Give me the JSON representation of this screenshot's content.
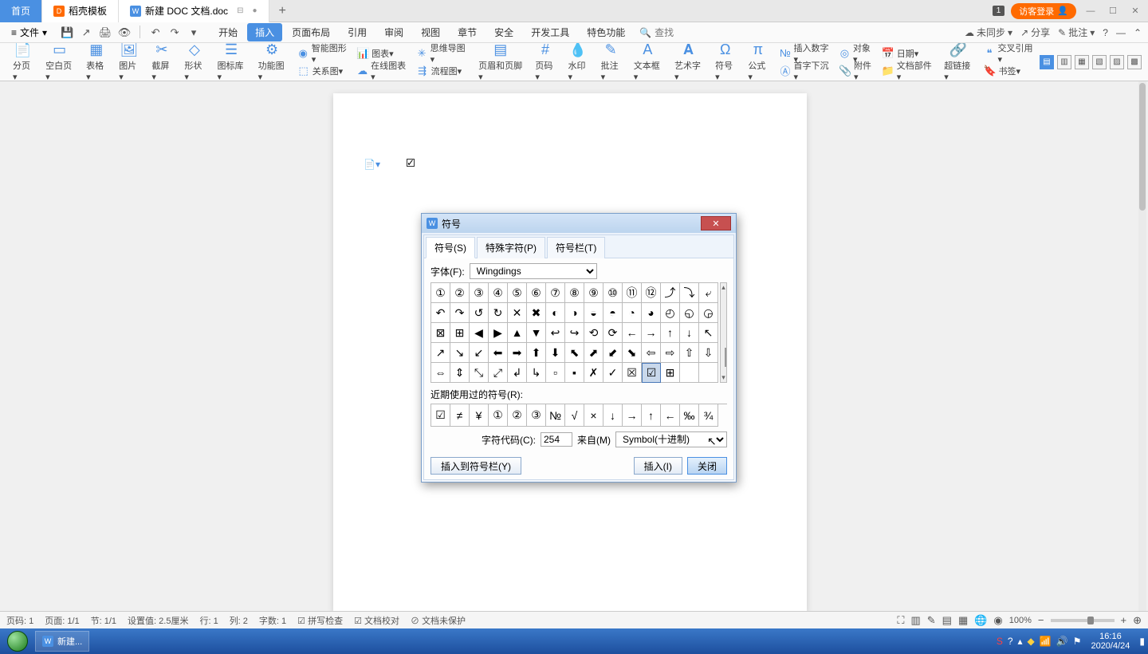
{
  "tabs": {
    "home": "首页",
    "template": "稻壳模板",
    "doc": "新建 DOC 文档.doc"
  },
  "top_right": {
    "badge": "1",
    "login": "访客登录"
  },
  "file_menu": "文件",
  "menu_tabs": [
    "开始",
    "插入",
    "页面布局",
    "引用",
    "审阅",
    "视图",
    "章节",
    "安全",
    "开发工具",
    "特色功能"
  ],
  "search": "查找",
  "menu_right": {
    "sync": "未同步",
    "share": "分享",
    "annotate": "批注"
  },
  "ribbon": {
    "big": [
      {
        "icon": "📄",
        "label": "分页"
      },
      {
        "icon": "▭",
        "label": "空白页"
      },
      {
        "icon": "▦",
        "label": "表格"
      },
      {
        "icon": "🖼",
        "label": "图片"
      },
      {
        "icon": "✂",
        "label": "截屏"
      },
      {
        "icon": "◇",
        "label": "形状"
      },
      {
        "icon": "☰",
        "label": "图标库"
      },
      {
        "icon": "⚙",
        "label": "功能图"
      }
    ],
    "group1": [
      {
        "icon": "◉",
        "label": "智能图形"
      },
      {
        "icon": "⬚",
        "label": "关系图"
      }
    ],
    "group2": [
      {
        "icon": "📊",
        "label": "图表"
      },
      {
        "icon": "☁",
        "label": "在线图表"
      }
    ],
    "group3": [
      {
        "icon": "✳",
        "label": "思维导图"
      },
      {
        "icon": "⇶",
        "label": "流程图"
      }
    ],
    "big2": [
      {
        "icon": "▤",
        "label": "页眉和页脚"
      },
      {
        "icon": "#",
        "label": "页码"
      },
      {
        "icon": "💧",
        "label": "水印"
      },
      {
        "icon": "✎",
        "label": "批注"
      },
      {
        "icon": "A",
        "label": "文本框"
      },
      {
        "icon": "𝐀",
        "label": "艺术字"
      },
      {
        "icon": "Ω",
        "label": "符号"
      },
      {
        "icon": "π",
        "label": "公式"
      }
    ],
    "group4": [
      {
        "icon": "№",
        "label": "插入数字"
      },
      {
        "icon": "Ⓐ",
        "label": "首字下沉"
      }
    ],
    "group5": [
      {
        "icon": "◎",
        "label": "对象"
      },
      {
        "icon": "📎",
        "label": "附件"
      }
    ],
    "group6": [
      {
        "icon": "📅",
        "label": "日期"
      },
      {
        "icon": "📁",
        "label": "文档部件"
      }
    ],
    "big3": [
      {
        "icon": "🔗",
        "label": "超链接"
      }
    ],
    "group7": [
      {
        "icon": "❝",
        "label": "交叉引用"
      },
      {
        "icon": "🔖",
        "label": "书签"
      }
    ]
  },
  "dialog": {
    "title": "符号",
    "tabs": [
      "符号(S)",
      "特殊字符(P)",
      "符号栏(T)"
    ],
    "font_label": "字体(F):",
    "font_value": "Wingdings",
    "grid": [
      [
        "①",
        "②",
        "③",
        "④",
        "⑤",
        "⑥",
        "⑦",
        "⑧",
        "⑨",
        "⑩",
        "⑪",
        "⑫",
        "⤴",
        "⤵",
        "⤶"
      ],
      [
        "↶",
        "↷",
        "↺",
        "↻",
        "✕",
        "✖",
        "◐",
        "◑",
        "◒",
        "◓",
        "◔",
        "◕",
        "◴",
        "◵",
        "◶"
      ],
      [
        "⊠",
        "⊞",
        "◀",
        "▶",
        "▲",
        "▼",
        "↩",
        "↪",
        "⟲",
        "⟳",
        "←",
        "→",
        "↑",
        "↓",
        "↖"
      ],
      [
        "↗",
        "↘",
        "↙",
        "⬅",
        "➡",
        "⬆",
        "⬇",
        "⬉",
        "⬈",
        "⬋",
        "⬊",
        "⇦",
        "⇨",
        "⇧",
        "⇩"
      ],
      [
        "⇔",
        "⇕",
        "⤡",
        "⤢",
        "↲",
        "↳",
        "▫",
        "▪",
        "✗",
        "✓",
        "☒",
        "☑",
        "⊞",
        "",
        ""
      ]
    ],
    "selected": [
      4,
      11
    ],
    "recent_label": "近期使用过的符号(R):",
    "recent": [
      "☑",
      "≠",
      "¥",
      "①",
      "②",
      "③",
      "№",
      "√",
      "×",
      "↓",
      "→",
      "↑",
      "←",
      "‰",
      "¾"
    ],
    "code_label": "字符代码(C):",
    "code_value": "254",
    "from_label": "来自(M)",
    "from_value": "Symbol(十进制)",
    "btn_insert_bar": "插入到符号栏(Y)",
    "btn_insert": "插入(I)",
    "btn_close": "关闭"
  },
  "status": {
    "page": "页码: 1",
    "pages": "页面: 1/1",
    "section": "节: 1/1",
    "pos": "设置值: 2.5厘米",
    "line": "行: 1",
    "col": "列: 2",
    "chars": "字数: 1",
    "spell": "拼写检查",
    "proof": "文档校对",
    "protect": "文档未保护",
    "zoom": "100%"
  },
  "taskbar": {
    "app": "新建...",
    "time": "16:16",
    "date": "2020/4/24"
  }
}
